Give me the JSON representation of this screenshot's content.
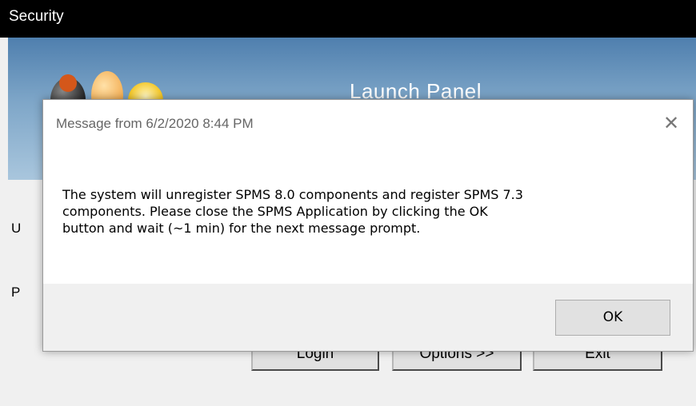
{
  "window": {
    "title": "Security"
  },
  "banner": {
    "title": "Launch Panel"
  },
  "side_letters": [
    "U",
    "P"
  ],
  "buttons": {
    "login": "Login",
    "options": "Options >>",
    "exit": "Exit"
  },
  "dialog": {
    "title": "Message from  6/2/2020 8:44 PM",
    "message_lines": [
      "The system will unregister SPMS 8.0 components and register SPMS 7.3",
      "components. Please close the SPMS Application by clicking the OK",
      "button and wait (~1 min) for the next message prompt."
    ],
    "ok_label": "OK",
    "close_glyph": "✕"
  },
  "colors": {
    "titlebar": "#000000",
    "banner_top": "#4f7fae",
    "dialog_bg": "#ffffff",
    "footer_bg": "#f0f0f0"
  }
}
